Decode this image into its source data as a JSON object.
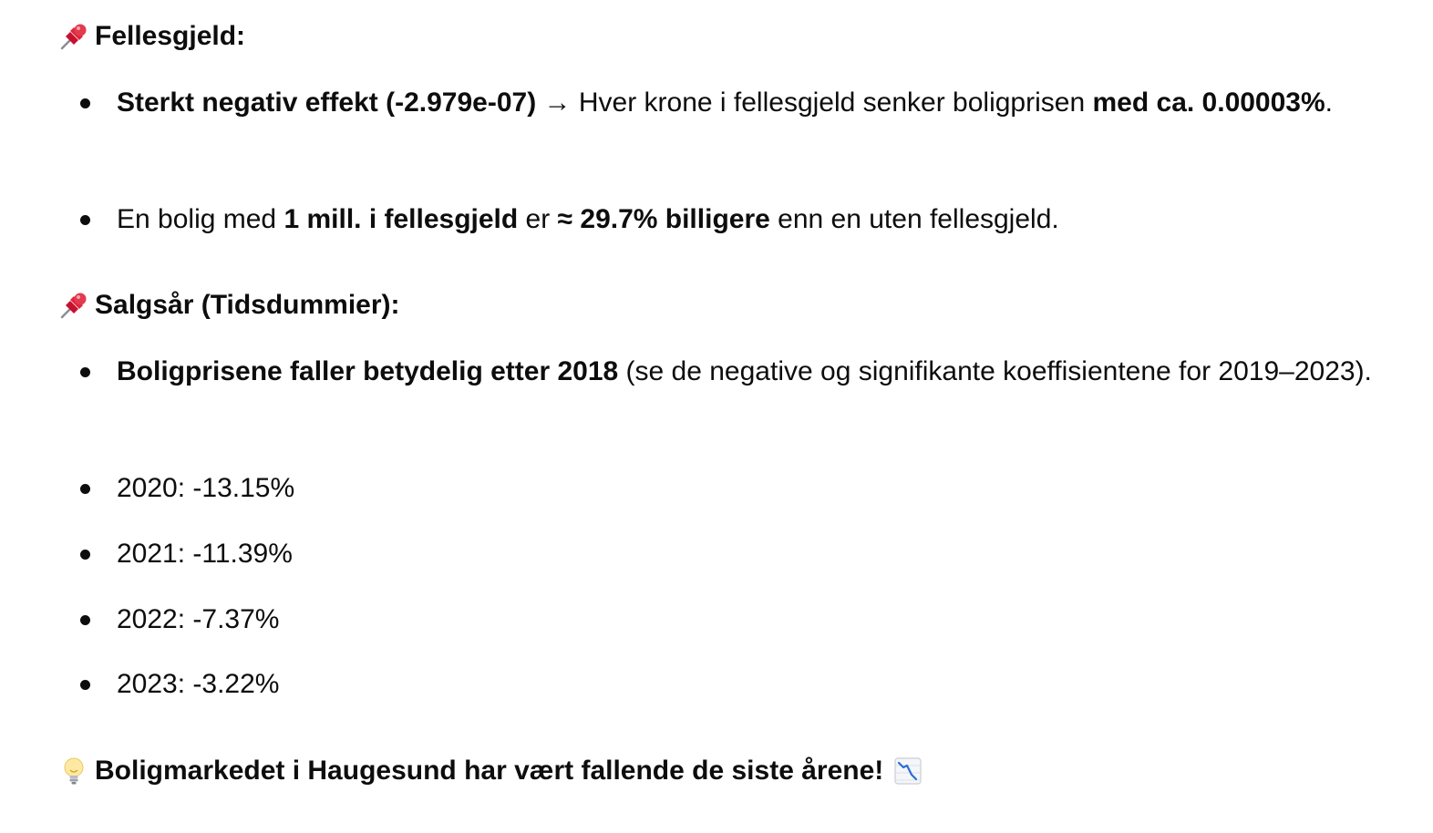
{
  "sections": [
    {
      "icon": "pushpin-icon",
      "heading": "Fellesgjeld:",
      "items": [
        {
          "parts": [
            {
              "text": "Sterkt negativ effekt (-2.979e-07)",
              "bold": true
            },
            {
              "text": " → Hver krone i fellesgjeld senker boligprisen ",
              "bold": false
            },
            {
              "text": "med ca. 0.00003%",
              "bold": true
            },
            {
              "text": ".",
              "bold": false
            }
          ]
        },
        {
          "parts": [
            {
              "text": "En bolig med ",
              "bold": false
            },
            {
              "text": "1 mill. i fellesgjeld",
              "bold": true
            },
            {
              "text": " er ",
              "bold": false
            },
            {
              "text": "≈ 29.7% billigere",
              "bold": true
            },
            {
              "text": " enn en uten fellesgjeld.",
              "bold": false
            }
          ]
        }
      ]
    },
    {
      "icon": "pushpin-icon",
      "heading": "Salgsår (Tidsdummier):",
      "items": [
        {
          "parts": [
            {
              "text": "Boligprisene faller betydelig etter 2018",
              "bold": true
            },
            {
              "text": " (se de negative og signifikante koeffisientene for 2019–2023).",
              "bold": false
            }
          ]
        },
        {
          "parts": [
            {
              "text": "2020: -13.15%",
              "bold": false
            }
          ]
        },
        {
          "parts": [
            {
              "text": "2021: -11.39%",
              "bold": false
            }
          ]
        },
        {
          "parts": [
            {
              "text": "2022: -7.37%",
              "bold": false
            }
          ]
        },
        {
          "parts": [
            {
              "text": "2023: -3.22%",
              "bold": false
            }
          ]
        }
      ]
    }
  ],
  "conclusion": {
    "icon": "lightbulb-icon",
    "text": "Boligmarkedet i Haugesund har vært fallende de siste årene!",
    "trailing_icon": "chart-decreasing-icon"
  }
}
